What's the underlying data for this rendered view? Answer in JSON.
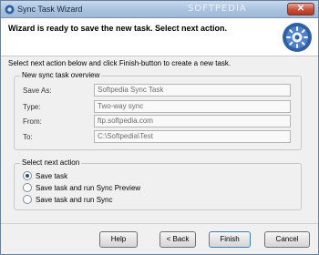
{
  "window": {
    "title": "Sync Task Wizard",
    "watermark": "SOFTPEDIA",
    "close_label": "✕"
  },
  "header": {
    "title": "Wizard is ready to save the new task. Select next action."
  },
  "instruction": "Select next action below and click Finish-button to create a new task.",
  "overview": {
    "legend": "New sync task overview",
    "fields": [
      {
        "label": "Save As:",
        "value": "Softpedia Sync Task"
      },
      {
        "label": "Type:",
        "value": "Two-way sync"
      },
      {
        "label": "From:",
        "value": "ftp.softpedia.com"
      },
      {
        "label": "To:",
        "value": "C:\\Softpedia\\Test"
      }
    ]
  },
  "next_action": {
    "legend": "Select next action",
    "options": [
      {
        "label": "Save task",
        "checked": true
      },
      {
        "label": "Save task and run Sync Preview",
        "checked": false
      },
      {
        "label": "Save task and run Sync",
        "checked": false
      }
    ]
  },
  "buttons": {
    "help": "Help",
    "back": "< Back",
    "finish": "Finish",
    "cancel": "Cancel"
  },
  "colors": {
    "title_bar": "#a9c2e0",
    "close_button": "#c7503a",
    "logo": "#2f5fa6"
  }
}
